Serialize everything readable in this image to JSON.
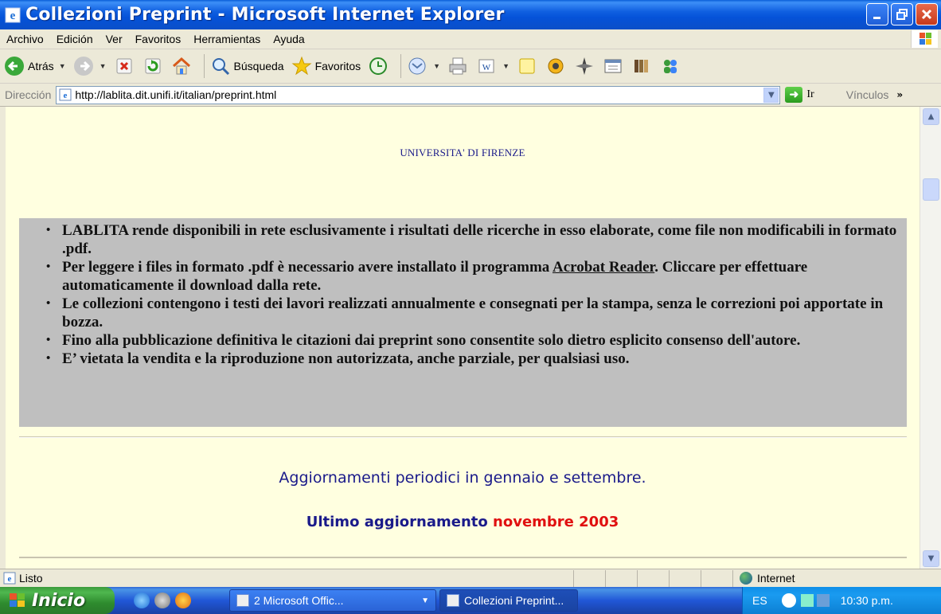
{
  "window": {
    "title": "Collezioni Preprint - Microsoft Internet Explorer",
    "controls": [
      "minimize",
      "maximize",
      "close"
    ]
  },
  "menu": {
    "items": [
      "Archivo",
      "Edición",
      "Ver",
      "Favoritos",
      "Herramientas",
      "Ayuda"
    ]
  },
  "toolbar": {
    "back_label": "Atrás",
    "search_label": "Búsqueda",
    "favorites_label": "Favoritos"
  },
  "address": {
    "label": "Dirección",
    "url": "http://lablita.dit.unifi.it/italian/preprint.html",
    "go_label": "Ir",
    "links_label": "Vínculos"
  },
  "page": {
    "university": "UNIVERSITA' DI FIRENZE",
    "notices": [
      {
        "text": "LABLITA rende disponibili in rete esclusivamente i risultati delle ricerche in esso elaborate, come file non modificabili in formato .pdf."
      },
      {
        "before": "Per leggere i files in formato .pdf è necessario avere installato il programma ",
        "link": "Acrobat Reader",
        "after": ". Cliccare per effettuare automaticamente il download dalla rete."
      },
      {
        "text": "Le collezioni contengono i testi dei lavori realizzati annualmente e consegnati per la stampa, senza le correzioni poi apportate in bozza."
      },
      {
        "text": "Fino alla pubblicazione definitiva le citazioni dai preprint sono consentite solo dietro esplicito consenso dell'autore."
      },
      {
        "text": "E’ vietata la vendita e la riproduzione non autorizzata, anche parziale, per qualsiasi uso."
      }
    ],
    "periodic_update": "Aggiornamenti periodici in gennaio e settembre.",
    "last_update_label": "Ultimo aggiornamento",
    "last_update_value": "novembre 2003",
    "colors": {
      "background": "#ffffe0",
      "notice_box": "#bfbfbf",
      "heading_text": "#1a1a8a",
      "highlight": "#e01010"
    }
  },
  "status": {
    "text": "Listo",
    "zone": "Internet"
  },
  "taskbar": {
    "start_label": "Inicio",
    "tasks": [
      "2 Microsoft Offic...",
      "Collezioni Preprint..."
    ],
    "language": "ES",
    "clock": "10:30 p.m."
  }
}
